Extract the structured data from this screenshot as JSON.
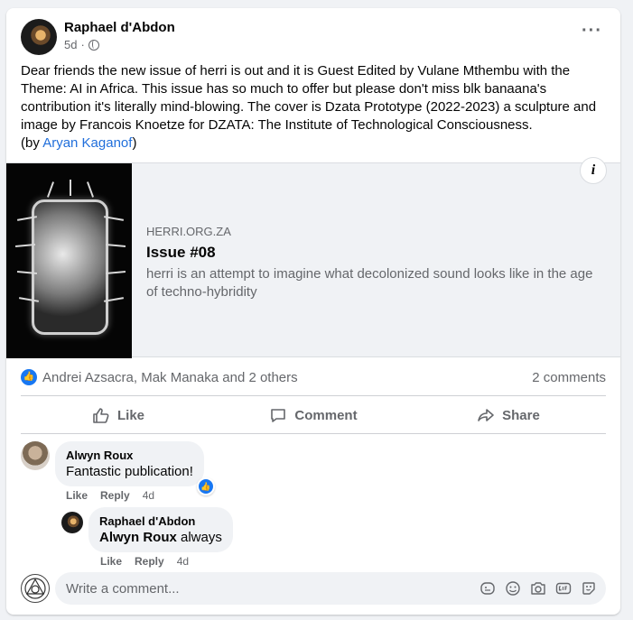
{
  "post": {
    "author": "Raphael d'Abdon",
    "time": "5d",
    "text_main": "Dear friends the new issue of herri is out and it is Guest Edited by Vulane Mthembu with the Theme: AI in Africa. This issue has so much to offer but please don't miss blk banaana's contribution it's literally mind-blowing. The cover is Dzata Prototype (2022-2023) a sculpture and image by Francois Knoetze for DZATA: The Institute of Technological Consciousness.",
    "byline_prefix": "(by ",
    "byline_link": "Aryan Kaganof",
    "byline_suffix": ")"
  },
  "link_preview": {
    "domain": "HERRI.ORG.ZA",
    "title": "Issue #08",
    "description": "herri is an attempt to imagine what decolonized sound looks like in the age of techno-hybridity",
    "info_label": "i"
  },
  "reactions": {
    "names": "Andrei Azsacra, Mak Manaka and 2 others",
    "comments_count": "2 comments"
  },
  "actions": {
    "like": "Like",
    "comment": "Comment",
    "share": "Share"
  },
  "comments": [
    {
      "author": "Alwyn Roux",
      "text": "Fantastic publication!",
      "like_label": "Like",
      "reply_label": "Reply",
      "time": "4d"
    },
    {
      "author": "Raphael d'Abdon",
      "mention": "Alwyn Roux",
      "text": " always",
      "like_label": "Like",
      "reply_label": "Reply",
      "time": "4d"
    }
  ],
  "composer": {
    "placeholder": "Write a comment..."
  },
  "colors": {
    "accent": "#1877f2",
    "link": "#216fdb",
    "secondary_text": "#65676b"
  }
}
